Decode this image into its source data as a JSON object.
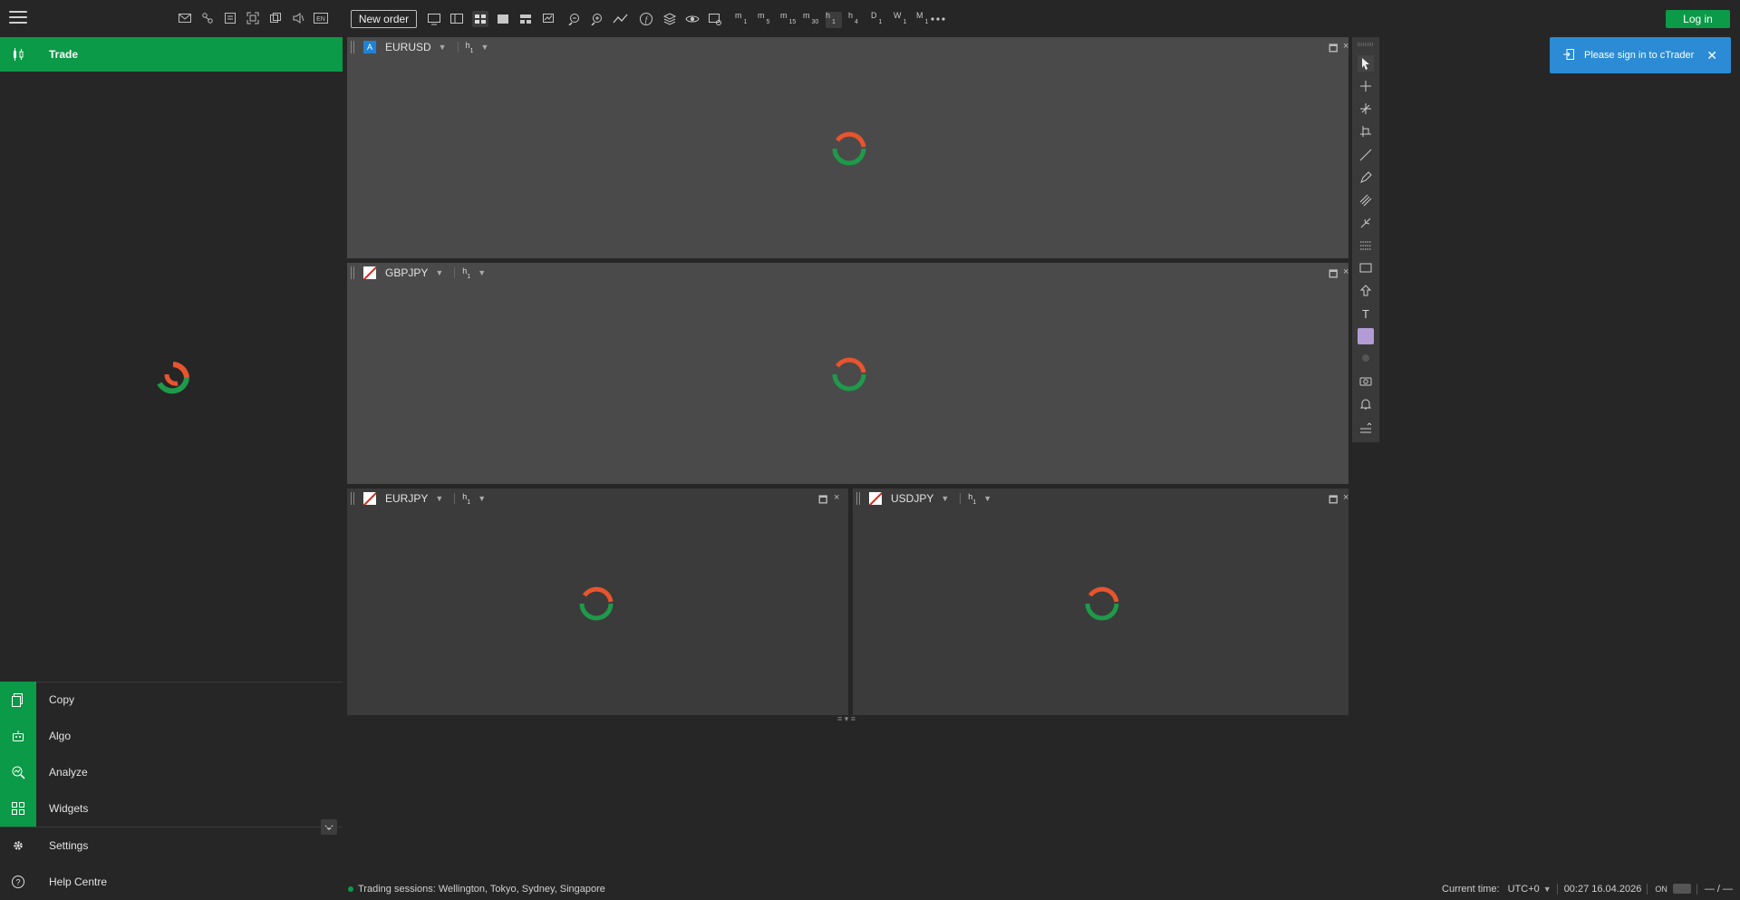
{
  "sidebar": {
    "trade_label": "Trade",
    "items": [
      {
        "label": "Copy",
        "icon": "copy-icon"
      },
      {
        "label": "Algo",
        "icon": "robot-icon"
      },
      {
        "label": "Analyze",
        "icon": "analyze-icon"
      },
      {
        "label": "Widgets",
        "icon": "widgets-icon"
      },
      {
        "label": "Settings",
        "icon": "gear-icon"
      },
      {
        "label": "Help Centre",
        "icon": "help-icon"
      }
    ]
  },
  "toolbar": {
    "new_order_label": "New order",
    "language_badge": "EN",
    "timeframes": [
      {
        "t": "m",
        "n": "1"
      },
      {
        "t": "m",
        "n": "5"
      },
      {
        "t": "m",
        "n": "15"
      },
      {
        "t": "m",
        "n": "30"
      },
      {
        "t": "h",
        "n": "1"
      },
      {
        "t": "h",
        "n": "4"
      },
      {
        "t": "D",
        "n": "1"
      },
      {
        "t": "W",
        "n": "1"
      },
      {
        "t": "M",
        "n": "1"
      }
    ],
    "active_timeframe": "h1",
    "login_label": "Log in"
  },
  "charts": [
    {
      "symbol": "EURUSD",
      "tf": "h",
      "tf_n": "1",
      "flag": "A"
    },
    {
      "symbol": "GBPJPY",
      "tf": "h",
      "tf_n": "1"
    },
    {
      "symbol": "EURJPY",
      "tf": "h",
      "tf_n": "1"
    },
    {
      "symbol": "USDJPY",
      "tf": "h",
      "tf_n": "1"
    }
  ],
  "notification": {
    "text": "Please sign in to cTrader"
  },
  "status": {
    "sessions": "Trading sessions: Wellington, Tokyo, Sydney, Singapore",
    "current_time_label": "Current time:",
    "timezone": "UTC+0",
    "datetime": "00:27 16.04.2026",
    "on_label": "ON",
    "tail": "— / —"
  },
  "colors": {
    "accent": "#0b9a47",
    "notification": "#2b8bd4",
    "spinner_green": "#1f9a4a",
    "spinner_red": "#e8542e"
  }
}
